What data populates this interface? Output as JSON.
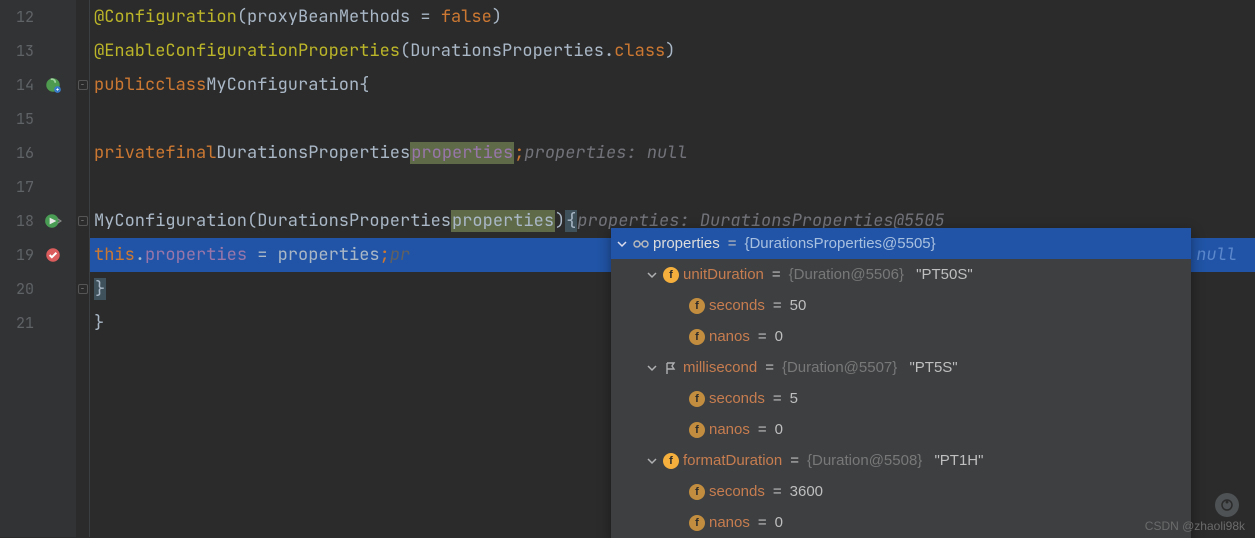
{
  "gutter": {
    "lines": [
      "12",
      "13",
      "14",
      "15",
      "16",
      "17",
      "18",
      "19",
      "20",
      "21"
    ],
    "icons": {
      "14": "bean-icon",
      "18": "run-icon",
      "19": "breakpoint-icon"
    }
  },
  "code": {
    "l12": {
      "ann": "@Configuration",
      "paramName": "proxyBeanMethods",
      "eq": " = ",
      "val": "false",
      "close": ")"
    },
    "l13": {
      "ann": "@EnableConfigurationProperties",
      "open": "(",
      "cls": "DurationsProperties",
      "dot": ".",
      "suffix": "class",
      "close": ")"
    },
    "l14": {
      "kw1": "public",
      "kw2": "class",
      "name": "MyConfiguration",
      "brace": "{"
    },
    "l16": {
      "kw1": "private",
      "kw2": "final",
      "type": "DurationsProperties",
      "name": "properties",
      "semi": ";",
      "hint": "properties: null"
    },
    "l18": {
      "ctor": "MyConfiguration",
      "open": "(",
      "type": "DurationsProperties",
      "param": "properties",
      "close": ")",
      "brace": "{",
      "hint": "properties: DurationsProperties@5505"
    },
    "l19": {
      "thiskw": "this",
      "dot": ".",
      "field": "properties",
      "eq": " = ",
      "rhs": "properties",
      "semi": ";",
      "hint": "pr",
      "trail": "null"
    },
    "l20": {
      "brace": "}"
    },
    "l21": {
      "brace": "}"
    }
  },
  "debug": {
    "root": {
      "name": "properties",
      "type": "{DurationsProperties@5505}"
    },
    "children": [
      {
        "name": "unitDuration",
        "type": "{Duration@5506}",
        "str": "\"PT50S\"",
        "icon": "f",
        "seconds": "50",
        "nanos": "0"
      },
      {
        "name": "millisecond",
        "type": "{Duration@5507}",
        "str": "\"PT5S\"",
        "icon": "flag",
        "seconds": "5",
        "nanos": "0"
      },
      {
        "name": "formatDuration",
        "type": "{Duration@5508}",
        "str": "\"PT1H\"",
        "icon": "f",
        "seconds": "3600",
        "nanos": "0"
      }
    ],
    "labels": {
      "seconds": "seconds",
      "nanos": "nanos"
    }
  },
  "watermark": "CSDN @zhaoli98k"
}
